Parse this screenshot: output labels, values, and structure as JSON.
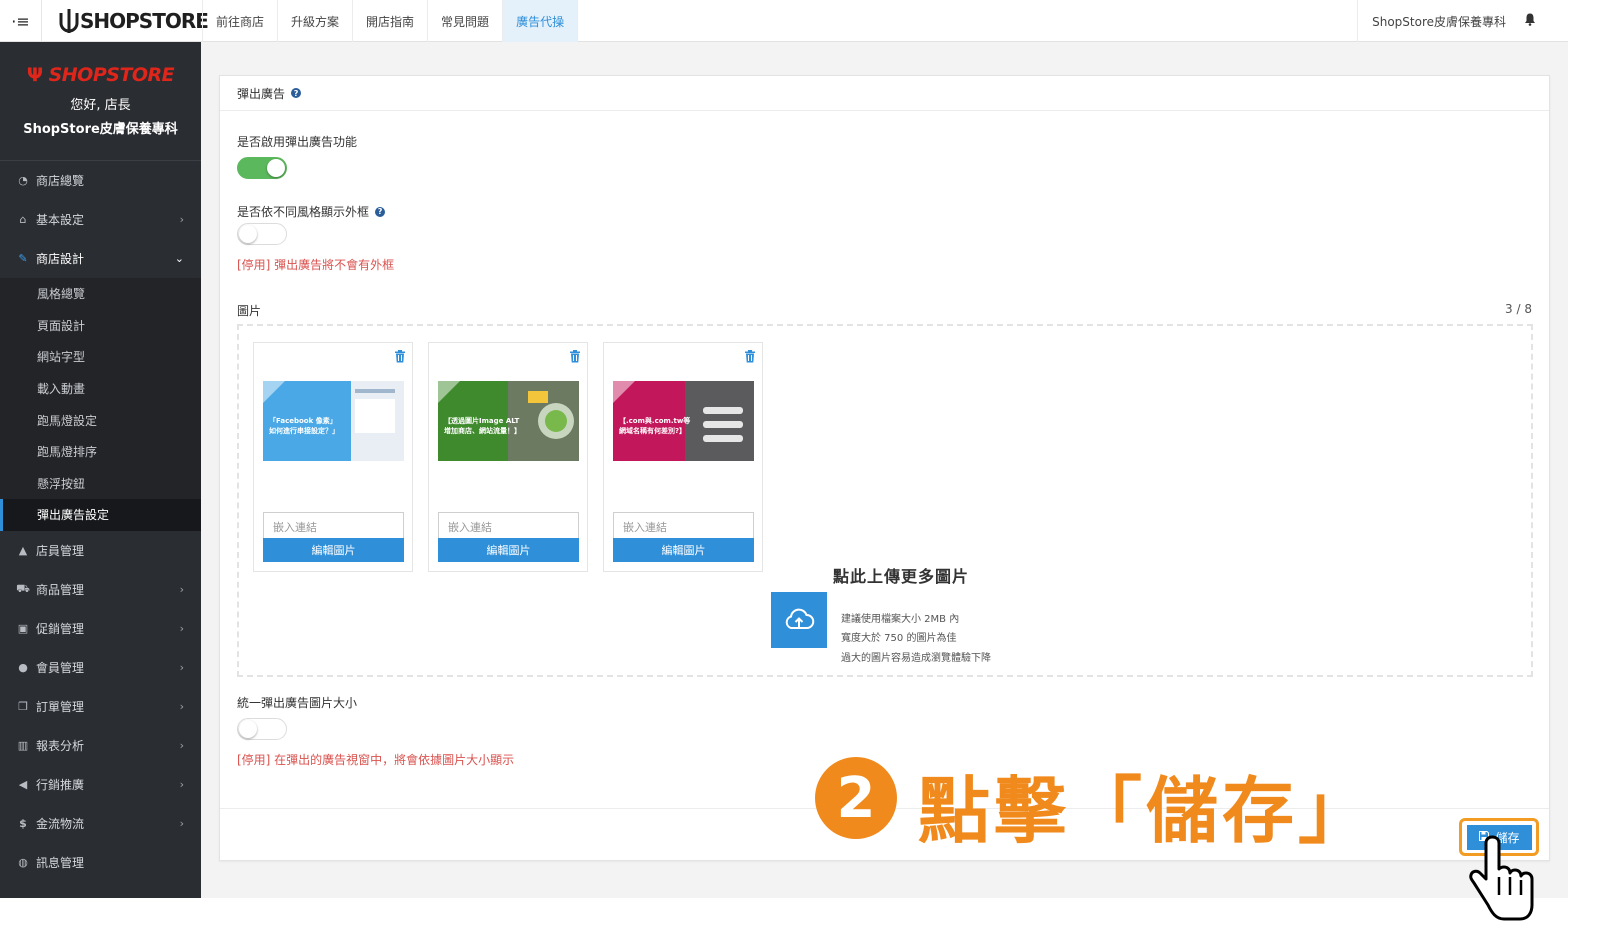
{
  "topbar": {
    "menu_icon": "menu-icon",
    "brand": "SHOPSTORE",
    "nav": [
      "前往商店",
      "升級方案",
      "開店指南",
      "常見問題",
      "廣告代操"
    ],
    "nav_active_index": 4,
    "store_name": "ShopStore皮膚保養專科",
    "bell_icon": "bell-icon"
  },
  "sidebar": {
    "brand": "SHOPSTORE",
    "greeting": "您好, 店長",
    "shop_name": "ShopStore皮膚保養專科",
    "items_before": [
      {
        "label": "商店總覽",
        "icon": "dashboard-icon",
        "chevron": false
      },
      {
        "label": "基本設定",
        "icon": "bank-icon",
        "chevron": true
      },
      {
        "label": "商店設計",
        "icon": "magic-wand-icon",
        "chevron": true,
        "open": true
      }
    ],
    "subitems": [
      "風格總覽",
      "頁面設計",
      "網站字型",
      "載入動畫",
      "跑馬燈設定",
      "跑馬燈排序",
      "懸浮按鈕",
      "彈出廣告設定"
    ],
    "subitem_active_index": 7,
    "items_after": [
      {
        "label": "店員管理",
        "icon": "user-lock-icon",
        "chevron": false
      },
      {
        "label": "商品管理",
        "icon": "cart-icon",
        "chevron": true
      },
      {
        "label": "促銷管理",
        "icon": "gift-icon",
        "chevron": true
      },
      {
        "label": "會員管理",
        "icon": "users-icon",
        "chevron": true
      },
      {
        "label": "訂單管理",
        "icon": "copy-icon",
        "chevron": true
      },
      {
        "label": "報表分析",
        "icon": "bar-chart-icon",
        "chevron": true
      },
      {
        "label": "行銷推廣",
        "icon": "bullhorn-icon",
        "chevron": true
      },
      {
        "label": "金流物流",
        "icon": "dollar-icon",
        "chevron": true
      },
      {
        "label": "訊息管理",
        "icon": "comments-icon",
        "chevron": false
      }
    ]
  },
  "panel": {
    "title": "彈出廣告",
    "enable_label": "是否啟用彈出廣告功能",
    "enable_on": true,
    "frame_label": "是否依不同風格顯示外框",
    "frame_on": false,
    "frame_warning": "[停用] 彈出廣告將不會有外框",
    "images_label": "圖片",
    "images_count": "3 / 8",
    "cards": [
      {
        "title_line1": "「Facebook 像素」",
        "title_line2": "如何進行串接設定？」",
        "color": "#4aa8e6",
        "link_placeholder": "嵌入連結",
        "edit_label": "編輯圖片"
      },
      {
        "title_line1": "【透過圖片Image ALT",
        "title_line2": "增加商店、網站流量！】",
        "color": "#3f8a2c",
        "link_placeholder": "嵌入連結",
        "edit_label": "編輯圖片"
      },
      {
        "title_line1": "【.com與.com.tw等",
        "title_line2": "網域名稱有何差別?】",
        "color": "#c2185b",
        "link_placeholder": "嵌入連結",
        "edit_label": "編輯圖片"
      }
    ],
    "upload_title": "點此上傳更多圖片",
    "upload_hints": [
      "建議使用檔案大小 2MB 內",
      "寬度大於 750 的圖片為佳",
      "過大的圖片容易造成瀏覽體驗下降"
    ],
    "size_label": "統一彈出廣告圖片大小",
    "size_on": false,
    "size_warning": "[停用] 在彈出的廣告視窗中，將會依據圖片大小顯示",
    "save_label": "儲存"
  },
  "annotation": {
    "step_number": "2",
    "text": "點擊「儲存」",
    "color": "#f08a1c"
  }
}
